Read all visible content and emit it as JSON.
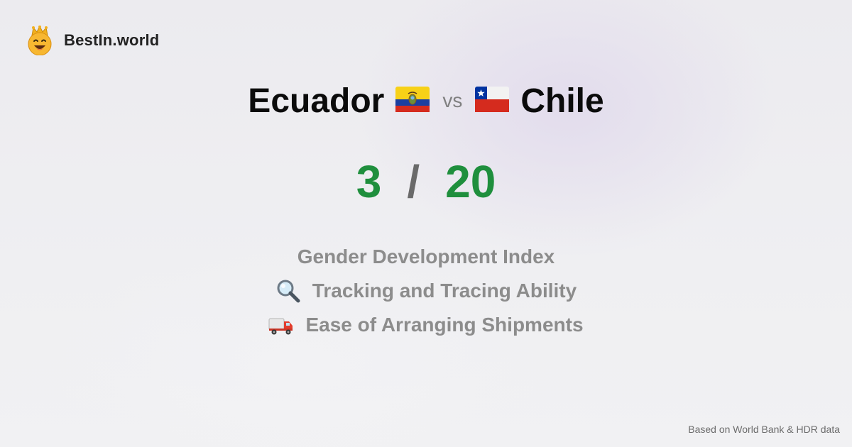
{
  "brand": {
    "name": "BestIn.world",
    "logo_icon": "crowned-smiley-icon"
  },
  "comparison": {
    "left_country": "Ecuador",
    "left_flag": "ecuador-flag-icon",
    "vs_label": "vs",
    "right_country": "Chile",
    "right_flag": "chile-flag-icon"
  },
  "scores": {
    "left": "3",
    "separator": "/",
    "right": "20",
    "score_color": "#1f8f3d"
  },
  "metrics": [
    {
      "label": "Gender Development Index",
      "icon": ""
    },
    {
      "label": "Tracking and Tracing Ability",
      "icon": "magnifying-glass-icon"
    },
    {
      "label": "Ease of Arranging Shipments",
      "icon": "delivery-truck-icon"
    }
  ],
  "footer": {
    "source": "Based on World Bank & HDR data"
  }
}
